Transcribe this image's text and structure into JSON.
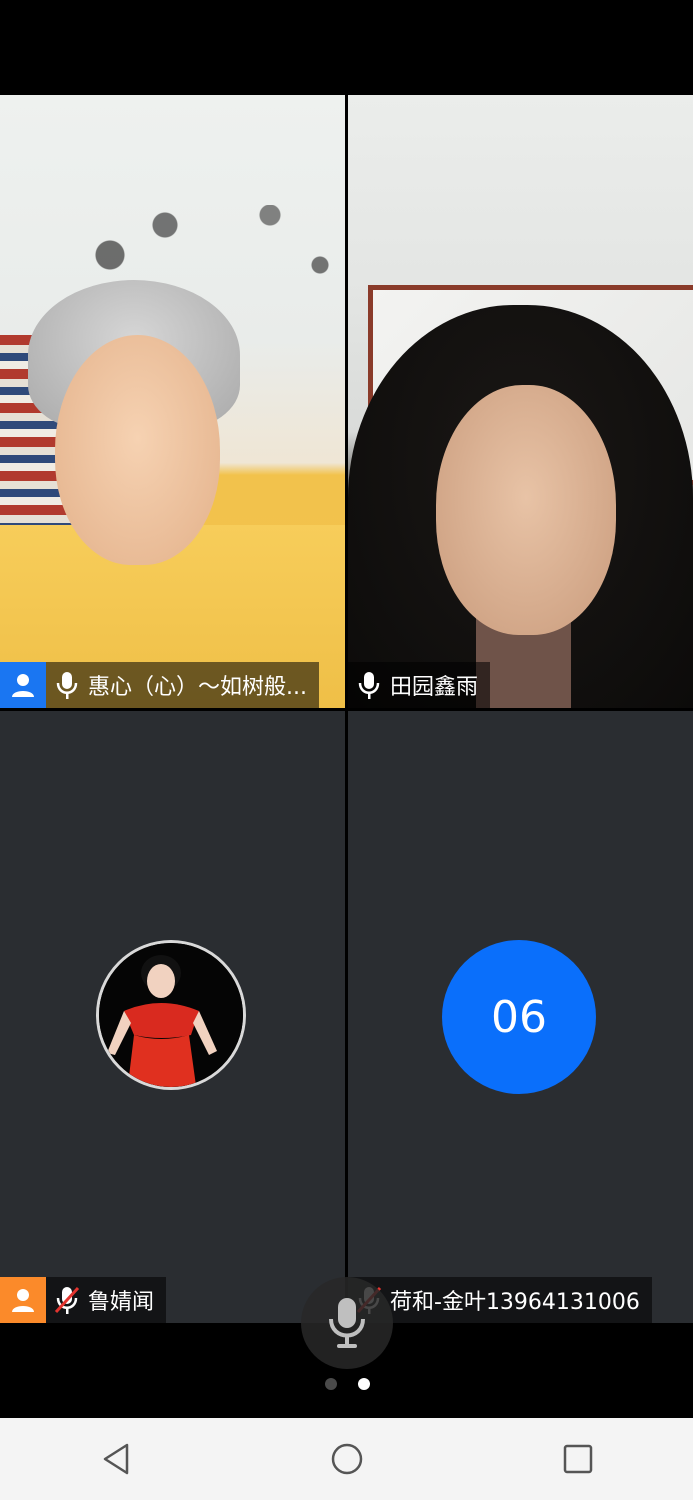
{
  "participants": [
    {
      "name": "惠心（心）～如树般...",
      "tag_color": "#1a76f2",
      "mic_icon": "mic-icon",
      "muted": false
    },
    {
      "name": "田园鑫雨",
      "mic_icon": "mic-icon",
      "muted": false
    },
    {
      "name": "鲁婧闻",
      "tag_color": "#fb8a2a",
      "mic_icon": "mic-muted-icon",
      "muted": true
    },
    {
      "name": "荷和-金叶13964131006",
      "avatar_text": "06",
      "avatar_color": "#0a6ffb",
      "mic_icon": "mic-muted-icon",
      "muted": true
    }
  ],
  "controls": {
    "floating_mic_icon": "mic-icon"
  },
  "pager": {
    "pages": 2,
    "current_page": 2
  },
  "nav": {
    "back_icon": "back-triangle-icon",
    "home_icon": "home-circle-icon",
    "recents_icon": "recents-square-icon"
  }
}
